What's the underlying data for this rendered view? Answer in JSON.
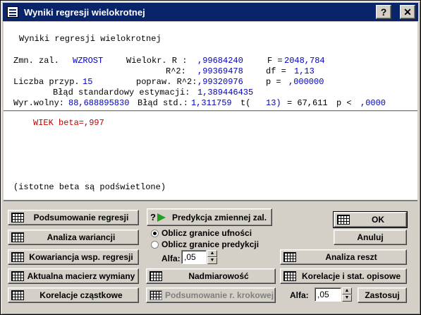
{
  "window": {
    "title": "Wyniki regresji wielokrotnej",
    "help_label": "?",
    "close_label": "✕"
  },
  "results": {
    "heading": "Wyniki regresji wielokrotnej",
    "dep_var_label": "Zmn. zal.",
    "dep_var_value": "WZROST",
    "mult_r_label": "Wielokr. R :",
    "mult_r_value": ",99684240",
    "f_label": "F =",
    "f_value": "2048,784",
    "r2_label": "R^2:",
    "r2_value": ",99369478",
    "df_label": "df =",
    "df_value": "1,13",
    "n_label": "Liczba przyp.",
    "n_value": "15",
    "adj_r2_label": "popraw. R^2:",
    "adj_r2_value": ",99320976",
    "p_label": "p =",
    "p_value": ",000000",
    "se_est_label": "Błąd standardowy estymacji:",
    "se_est_value": "1,389446435",
    "intercept_label": "Wyr.wolny:",
    "intercept_value": "88,688895830",
    "se_label": "Błąd std.:",
    "se_value": "1,311759",
    "t_label": "t(",
    "t_df": "13)",
    "t_eq": "= 67,611",
    "plt_label": "p <",
    "plt_value": ",0000"
  },
  "betas": {
    "entry": "WIEK beta=,997",
    "note": "(istotne beta są podświetlone)"
  },
  "buttons": {
    "summary": "Podsumowanie regresji",
    "anova": "Analiza wariancji",
    "covariance": "Kowariancja wsp. regresji",
    "sweep_matrix": "Aktualna macierz wymiany",
    "partial_corr": "Korelacje cząstkowe",
    "prediction": "Predykcja zmiennej zal.",
    "redundancy": "Nadmiarowość",
    "stepwise_summary": "Podsumowanie r. krokowej",
    "ok": "OK",
    "cancel": "Anuluj",
    "residuals": "Analiza reszt",
    "correlations": "Korelacje i stat. opisowe",
    "apply": "Zastosuj"
  },
  "options": {
    "confidence": "Oblicz granice ufności",
    "prediction_limits": "Oblicz granice predykcji",
    "confidence_selected": true,
    "alpha_label": "Alfa:",
    "alpha_value": ",05",
    "alpha2_label": "Alfa:",
    "alpha2_value": ",05"
  }
}
